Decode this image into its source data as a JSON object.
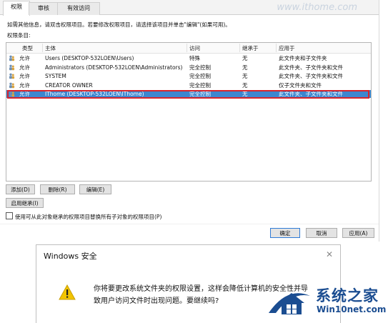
{
  "tabs": [
    {
      "label": "权限"
    },
    {
      "label": "审核"
    },
    {
      "label": "有效访问"
    }
  ],
  "watermark": "www.ithome.com",
  "hint": "如需其他信息，请双击权限项目。若要修改权限项目，请选择该项目并单击\"编辑\"(如果可用)。",
  "entries_label": "权限条目:",
  "columns": [
    "类型",
    "主体",
    "访问",
    "继承于",
    "应用于"
  ],
  "rows": [
    {
      "type": "允许",
      "principal": "Users (DESKTOP-532LOEN\\Users)",
      "access": "特殊",
      "inherited": "无",
      "applies": "此文件夹和子文件夹",
      "selected": false
    },
    {
      "type": "允许",
      "principal": "Administrators (DESKTOP-532LOEN\\Administrators)",
      "access": "完全控制",
      "inherited": "无",
      "applies": "此文件夹、子文件夹和文件",
      "selected": false
    },
    {
      "type": "允许",
      "principal": "SYSTEM",
      "access": "完全控制",
      "inherited": "无",
      "applies": "此文件夹、子文件夹和文件",
      "selected": false
    },
    {
      "type": "允许",
      "principal": "CREATOR OWNER",
      "access": "完全控制",
      "inherited": "无",
      "applies": "仅子文件夹和文件",
      "selected": false
    },
    {
      "type": "允许",
      "principal": "IThome (DESKTOP-532LOEN\\IThome)",
      "access": "完全控制",
      "inherited": "无",
      "applies": "此文件夹、子文件夹和文件",
      "selected": true
    }
  ],
  "buttons": {
    "add": "添加(D)",
    "remove": "删除(R)",
    "edit": "编辑(E)",
    "enable_inheritance": "启用继承(I)",
    "ok": "确定",
    "cancel": "取消",
    "apply": "应用(A)"
  },
  "replace_checkbox_label": "使用可从此对象继承的权限项目替换所有子对象的权限项目(P)",
  "security_dialog": {
    "title": "Windows 安全",
    "close": "✕",
    "line1": "你将要更改系统文件夹的权限设置，这样会降低计算机的安全性并导",
    "line2": "致用户访问文件时出现问题。要继续吗?"
  },
  "logo": {
    "title": "系统之家",
    "url": "Win10net.com"
  },
  "colors": {
    "selection": "#3d86cf",
    "highlight_border": "#d8242c",
    "warning": "#f2c400",
    "logo_blue": "#1b4d91"
  }
}
